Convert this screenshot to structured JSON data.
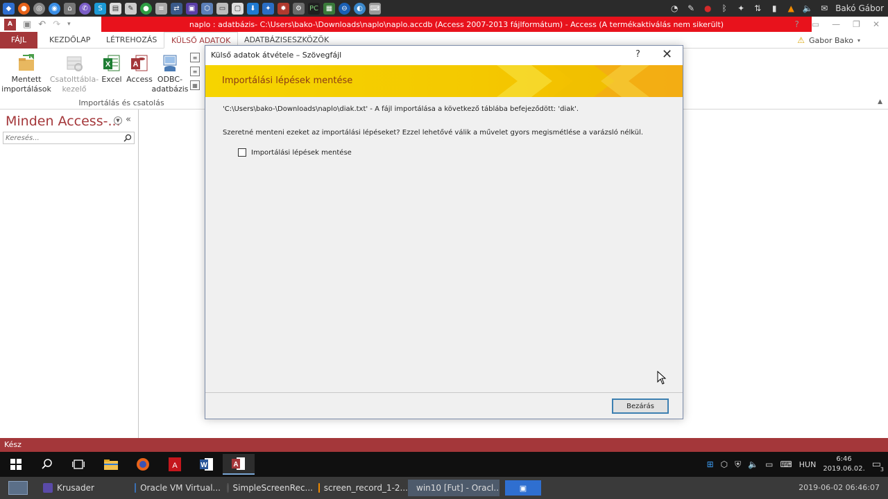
{
  "access": {
    "window_title": "naplo : adatbázis- C:\\Users\\bako-\\Downloads\\naplo\\naplo.accdb (Access 2007-2013 fájlformátum) - Access (A termékaktiválás nem sikerült)",
    "tabs": [
      "FÁJL",
      "KEZDŐLAP",
      "LÉTREHOZÁS",
      "KÜLSŐ ADATOK",
      "ADATBÁZISESZKÖZÖK"
    ],
    "user_name": "Gabor Bako",
    "help_label": "?",
    "ribbon": {
      "saved_imports": [
        "Mentett",
        "importálások"
      ],
      "linked_table_manager": [
        "Csatolttábla-",
        "kezelő"
      ],
      "excel": "Excel",
      "access": "Access",
      "odbc": [
        "ODBC-",
        "adatbázis"
      ],
      "group_label": "Importálás és csatolás"
    },
    "nav": {
      "title": "Minden Access-...",
      "search_placeholder": "Keresés..."
    },
    "status": "Kész"
  },
  "dialog": {
    "title": "Külső adatok átvétele – Szövegfájl",
    "help": "?",
    "banner": "Importálási lépések mentése",
    "message1": "'C:\\Users\\bako-\\Downloads\\naplo\\diak.txt' - A fájl importálása a következő táblába befejeződött: 'diak'.",
    "message2": "Szeretné menteni ezeket az importálási lépéseket? Ezzel lehetővé válik a művelet gyors megismétlése a varázsló nélkül.",
    "checkbox_label": "Importálási lépések mentése",
    "checkbox_checked": false,
    "close_button": "Bezárás"
  },
  "top_panel": {
    "user": "Bakó Gábor"
  },
  "windows_taskbar": {
    "language": "HUN",
    "time": "6:46",
    "date": "2019.06.02.",
    "notification_count": "3"
  },
  "bottom_panel": {
    "tasks": [
      "Krusader",
      "Oracle VM Virtual...",
      "SimpleScreenRec...",
      "screen_record_1-2...",
      "win10 [Fut] - Oracl..."
    ],
    "datetime": "2019-06-02 06:46:07"
  },
  "colors": {
    "access_brand": "#a4373a",
    "title_red": "#e8121c",
    "banner_yellow": "#f6d400"
  }
}
